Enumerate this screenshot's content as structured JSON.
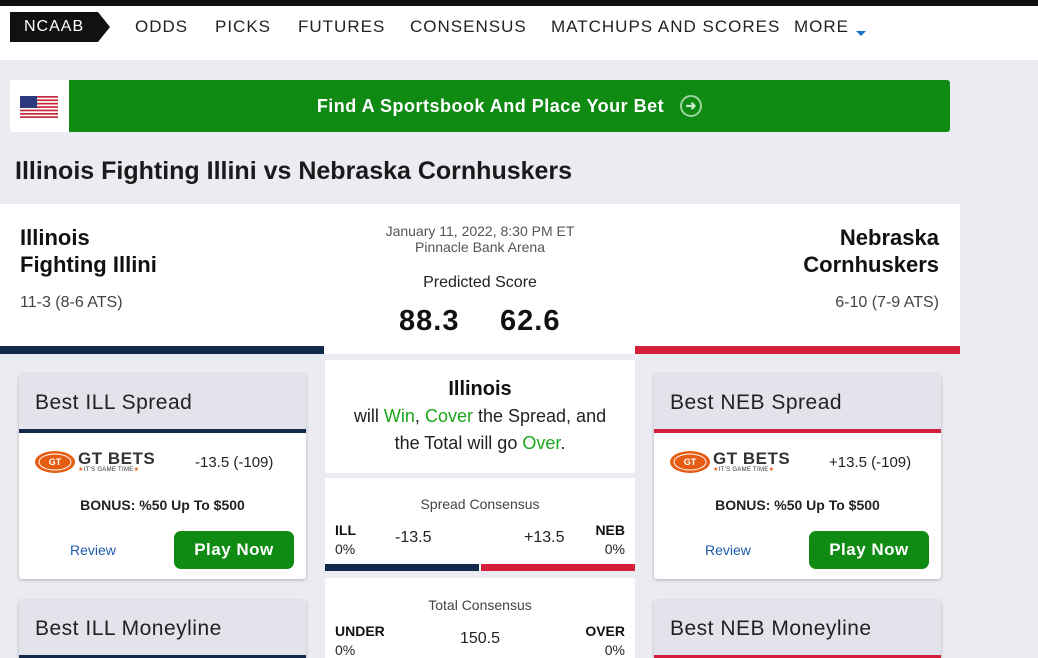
{
  "nav": {
    "badge": "NCAAB",
    "items": [
      "ODDS",
      "PICKS",
      "FUTURES",
      "CONSENSUS",
      "MATCHUPS AND SCORES",
      "MORE"
    ]
  },
  "banner": {
    "text": "Find A Sportsbook And Place Your Bet",
    "icon": "arrow-right-circle-icon",
    "flag": "us-flag-icon"
  },
  "page_title": "Illinois Fighting Illini vs Nebraska Cornhuskers",
  "matchup": {
    "home": {
      "name_line1": "Illinois",
      "name_line2": "Fighting Illini",
      "record": "11-3 (8-6 ATS)",
      "color": "#13294b"
    },
    "away": {
      "name_line1": "Nebraska",
      "name_line2": "Cornhuskers",
      "record": "6-10 (7-9 ATS)",
      "color": "#d31f3a"
    },
    "date": "January 11, 2022, 8:30 PM ET",
    "venue": "Pinnacle Bank Arena",
    "predicted_label": "Predicted Score",
    "home_score": "88.3",
    "away_score": "62.6"
  },
  "ill_spread": {
    "title": "Best ILL Spread",
    "book": "GT BETS",
    "book_tag": "IT'S GAME TIME",
    "odds": "-13.5 (-109)",
    "bonus": "BONUS: %50 Up To $500",
    "review": "Review",
    "play": "Play Now"
  },
  "neb_spread": {
    "title": "Best NEB Spread",
    "book": "GT BETS",
    "book_tag": "IT'S GAME TIME",
    "odds": "+13.5 (-109)",
    "bonus": "BONUS: %50 Up To $500",
    "review": "Review",
    "play": "Play Now"
  },
  "ill_moneyline": {
    "title": "Best ILL Moneyline"
  },
  "neb_moneyline": {
    "title": "Best NEB Moneyline"
  },
  "pick": {
    "team": "Illinois",
    "will": "will",
    "win": "Win",
    "comma": ",",
    "cover": "Cover",
    "spread_text": "the Spread, and",
    "total_text": "the Total will go",
    "over": "Over",
    "period": "."
  },
  "spread_consensus": {
    "title": "Spread Consensus",
    "left_abbr": "ILL",
    "left_pct": "0%",
    "left_line": "-13.5",
    "right_abbr": "NEB",
    "right_pct": "0%",
    "right_line": "+13.5",
    "left_share": 0.5
  },
  "total_consensus": {
    "title": "Total Consensus",
    "left_abbr": "UNDER",
    "left_pct": "0%",
    "total": "150.5",
    "right_abbr": "OVER",
    "right_pct": "0%"
  },
  "colors": {
    "green": "#0f8a13",
    "navy": "#13294b",
    "red": "#d31f3a",
    "accent_blue": "#1a73c8"
  }
}
